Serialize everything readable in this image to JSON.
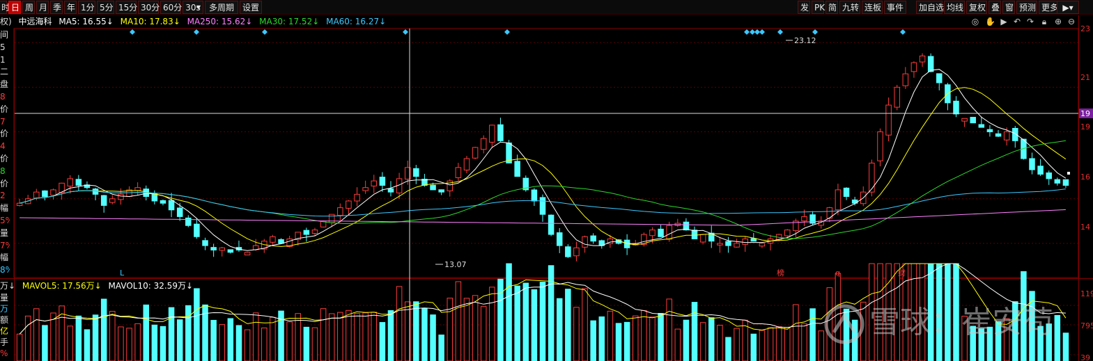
{
  "toolbar": {
    "periods": [
      "时",
      "日",
      "周",
      "月",
      "季",
      "年",
      "1分",
      "5分",
      "15分",
      "30分",
      "60分",
      "30s",
      "多周期",
      "设置"
    ],
    "active_period": "日",
    "right_buttons": [
      "发",
      "PK",
      "简",
      "九转",
      "连板",
      "事件",
      "加自选",
      "均线",
      "复权",
      "叠",
      "窗",
      "预测",
      "更多"
    ]
  },
  "legend": {
    "prefix": "权)",
    "stock": "中远海科",
    "ma5": "MA5: 16.55↓",
    "ma10": "MA10: 17.83↓",
    "ma250": "MA250: 15.62↓",
    "ma30": "MA30: 17.52↓",
    "ma60": "MA60: 16.27↓"
  },
  "vol_legend": {
    "prefix": "万↓",
    "mavol5": "MAVOL5: 17.56万↓",
    "mavol10": "MAVOL10: 32.59万↓"
  },
  "left_labels_top": [
    "间",
    "5",
    "1",
    "二",
    "盘",
    "8",
    "价",
    "7",
    "价",
    "4",
    "价",
    "8",
    "价",
    "2",
    "幅",
    "5%",
    "量",
    "7%",
    "幅",
    "8%"
  ],
  "left_labels_bottom": [
    "量",
    "万",
    "额",
    "亿",
    "手",
    "%"
  ],
  "right_axis": {
    "price_labels": [
      "23",
      "21",
      "19",
      "19",
      "16",
      "14"
    ],
    "vol_labels": [
      "119",
      "795",
      "39"
    ]
  },
  "annotations": {
    "high": "23.12",
    "low": "13.07",
    "marks": [
      "L",
      "榜",
      "q",
      "财"
    ]
  },
  "watermark": {
    "text": "雪球：崔安苟"
  },
  "colors": {
    "up": "#ff3b3b",
    "down": "#54ffff",
    "ma5": "#ffffff",
    "ma10": "#ffff00",
    "ma30": "#2bd92b",
    "ma60": "#3cc8ff",
    "ma250": "#ff80ff",
    "mavol5": "#ffff00",
    "mavol10": "#ffffff",
    "grid": "#5a0000"
  },
  "chart_data": {
    "type": "candlestick",
    "title": "中远海科",
    "price_range": [
      12.5,
      23.6
    ],
    "count": 125,
    "high": {
      "value": 23.12
    },
    "low": {
      "value": 13.07
    },
    "close_series": [
      15.8,
      16.0,
      16.3,
      16.1,
      16.4,
      16.7,
      16.9,
      16.6,
      16.5,
      16.2,
      15.7,
      16.0,
      16.2,
      16.4,
      16.5,
      16.1,
      15.9,
      15.8,
      15.5,
      15.2,
      14.8,
      14.3,
      13.9,
      13.7,
      13.8,
      13.6,
      13.7,
      13.6,
      13.9,
      14.1,
      14.3,
      14.0,
      14.2,
      14.5,
      14.4,
      14.6,
      15.0,
      15.3,
      15.6,
      15.9,
      16.2,
      16.5,
      16.8,
      16.6,
      16.3,
      16.9,
      17.4,
      17.0,
      16.6,
      16.4,
      16.3,
      16.8,
      17.4,
      17.8,
      18.3,
      18.7,
      19.3,
      18.6,
      17.6,
      17.0,
      16.4,
      15.9,
      15.3,
      14.4,
      13.9,
      13.4,
      13.8,
      14.3,
      14.1,
      13.9,
      14.2,
      14.0,
      13.8,
      14.0,
      14.4,
      14.6,
      14.3,
      14.8,
      14.9,
      14.6,
      14.2,
      14.4,
      14.1,
      14.0,
      13.9,
      14.0,
      14.2,
      14.1,
      14.0,
      14.2,
      14.4,
      14.6,
      15.0,
      15.2,
      14.9,
      15.0,
      15.6,
      16.4,
      16.1,
      15.8,
      16.3,
      17.6,
      19.0,
      20.2,
      21.0,
      21.6,
      22.1,
      22.4,
      21.7,
      21.2,
      20.3,
      19.8,
      19.6,
      19.4,
      19.2,
      19.0,
      18.8,
      19.0,
      18.6,
      17.8,
      17.3,
      17.1,
      16.9,
      16.7,
      16.6
    ],
    "ma": {
      "MA5": 16.55,
      "MA10": 17.83,
      "MA30": 17.52,
      "MA60": 16.27,
      "MA250": 15.62
    },
    "volume": {
      "MAVOL5": "17.56万",
      "MAVOL10": "32.59万"
    }
  }
}
